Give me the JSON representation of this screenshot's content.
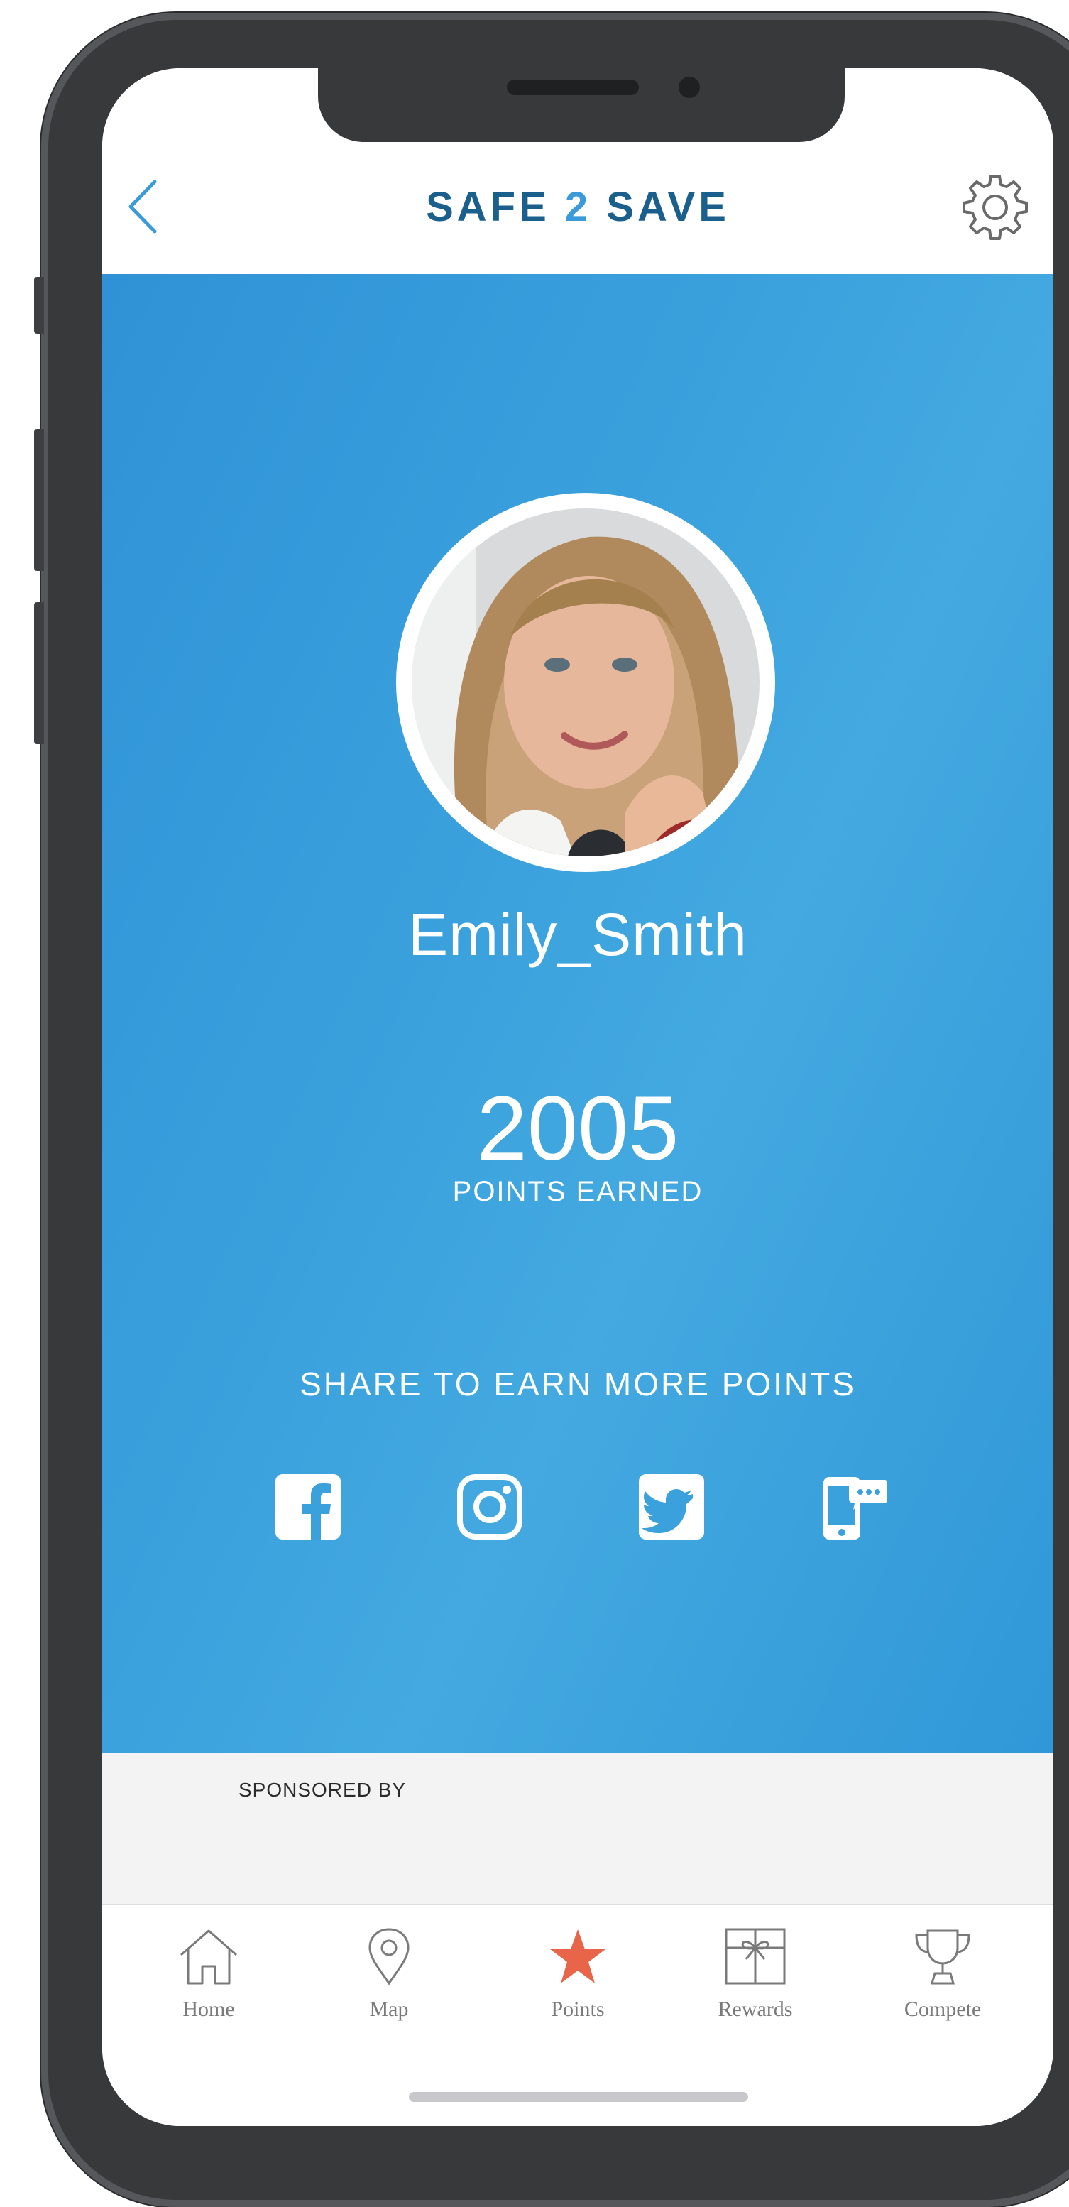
{
  "app": {
    "title_part1": "SAFE ",
    "title_number": "2",
    "title_part2": " SAVE"
  },
  "profile": {
    "username": "Emily_Smith",
    "points": "2005",
    "points_label": "POINTS EARNED"
  },
  "share": {
    "heading": "SHARE TO EARN MORE POINTS",
    "buttons": [
      "facebook-icon",
      "instagram-icon",
      "twitter-icon",
      "sms-icon"
    ]
  },
  "sponsor": {
    "label": "SPONSORED BY"
  },
  "tabs": [
    {
      "label": "Home",
      "icon": "home-icon",
      "active": false
    },
    {
      "label": "Map",
      "icon": "map-pin-icon",
      "active": false
    },
    {
      "label": "Points",
      "icon": "star-icon",
      "active": true
    },
    {
      "label": "Rewards",
      "icon": "gift-icon",
      "active": false
    },
    {
      "label": "Compete",
      "icon": "trophy-icon",
      "active": false
    }
  ],
  "colors": {
    "brand_dark": "#1b5f8d",
    "brand_accent": "#3b9ad9",
    "hero_blue": "#3aa1dd",
    "active_tab": "#e8654a"
  }
}
